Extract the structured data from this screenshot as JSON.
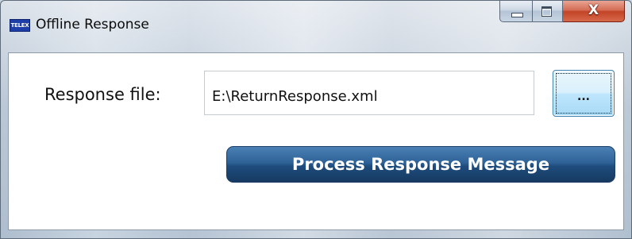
{
  "window": {
    "title": "Offline Response",
    "app_icon_text": "TELEX",
    "icons": {
      "app": "telex-app-icon",
      "minimize": "minimize-icon",
      "maximize": "maximize-icon",
      "close": "close-icon"
    },
    "close_glyph": "X"
  },
  "form": {
    "response_file_label": "Response file:",
    "response_file_value": "E:\\ReturnResponse.xml",
    "browse_label": "...",
    "process_button_label": "Process Response Message"
  },
  "colors": {
    "process_button": "#2f6398",
    "close_button": "#c24427",
    "browse_button": "#bee6fd"
  }
}
